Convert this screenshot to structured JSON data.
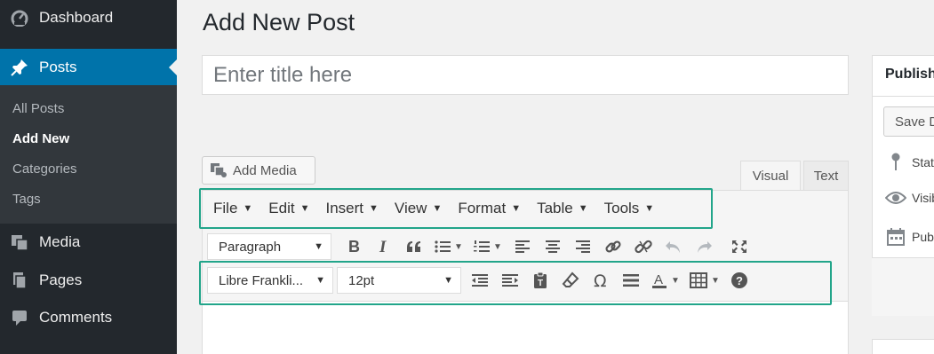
{
  "sidebar": {
    "dashboard": "Dashboard",
    "posts": "Posts",
    "submenu": [
      "All Posts",
      "Add New",
      "Categories",
      "Tags"
    ],
    "media": "Media",
    "pages": "Pages",
    "comments": "Comments"
  },
  "page": {
    "title": "Add New Post",
    "title_placeholder": "Enter title here"
  },
  "editor": {
    "add_media": "Add Media",
    "tab_visual": "Visual",
    "tab_text": "Text",
    "menubar": [
      "File",
      "Edit",
      "Insert",
      "View",
      "Format",
      "Table",
      "Tools"
    ],
    "format_select": "Paragraph",
    "font_family": "Libre Frankli...",
    "font_size": "12pt"
  },
  "publish": {
    "title": "Publish",
    "save_draft": "Save Draft",
    "status": "Status:",
    "visibility": "Visibility:",
    "publish_time": "Publish"
  },
  "colors": {
    "sidebar_bg": "#23282d",
    "active_blue": "#0073aa",
    "highlight_green": "#22a58a"
  }
}
